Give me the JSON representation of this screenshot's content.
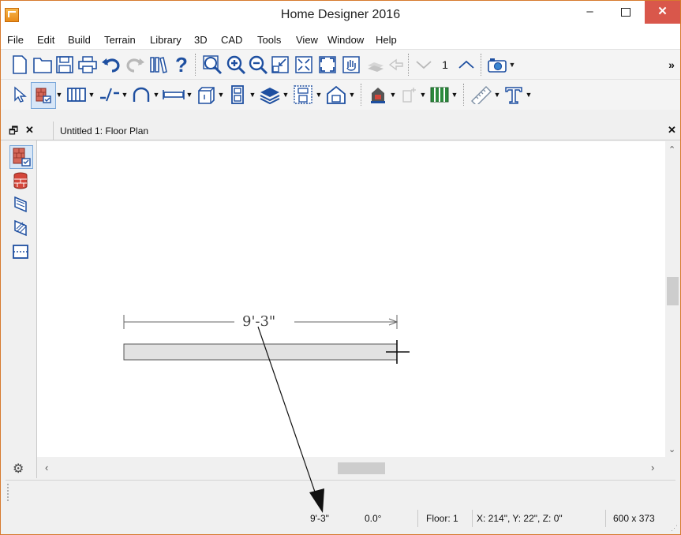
{
  "window": {
    "title": "Home Designer 2016"
  },
  "menu": [
    "File",
    "Edit",
    "Build",
    "Terrain",
    "Library",
    "3D",
    "CAD",
    "Tools",
    "View",
    "Window",
    "Help"
  ],
  "toolbar": {
    "floor_number": "1",
    "overflow": "»"
  },
  "tab": {
    "label": "Untitled 1: Floor Plan"
  },
  "drawing": {
    "dimension_label": "9'-3\""
  },
  "status": {
    "length": "9'-3\"",
    "angle": "0.0°",
    "floor": "Floor: 1",
    "coords": "X: 214\", Y: 22\", Z: 0\"",
    "size": "600 x 373"
  },
  "colors": {
    "accent": "#d77a2e",
    "close_button": "#d9574b",
    "icon_blue": "#1e4fa0",
    "icon_red": "#c83a2a"
  }
}
